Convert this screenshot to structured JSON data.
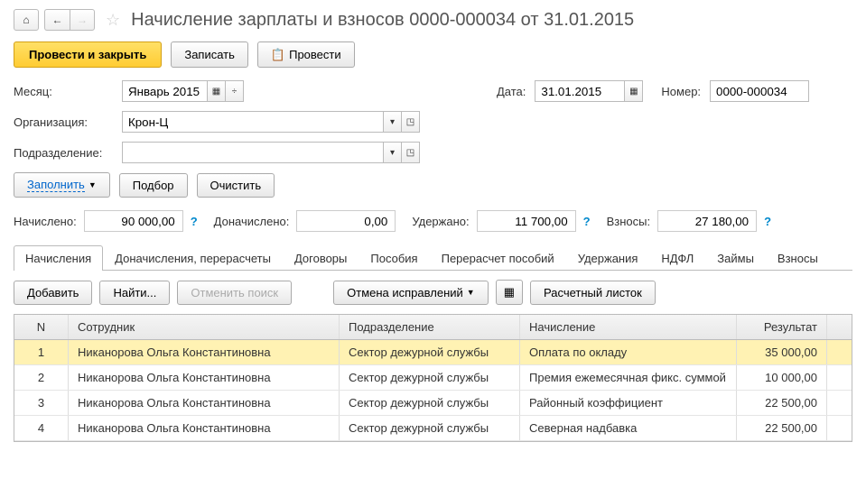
{
  "nav": {
    "home": "⌂",
    "back": "←",
    "fwd": "→"
  },
  "title": "Начисление зарплаты и взносов 0000-000034 от 31.01.2015",
  "toolbar": {
    "post_close": "Провести и закрыть",
    "save": "Записать",
    "post": "Провести"
  },
  "form": {
    "month_label": "Месяц:",
    "month_value": "Январь 2015",
    "date_label": "Дата:",
    "date_value": "31.01.2015",
    "number_label": "Номер:",
    "number_value": "0000-000034",
    "org_label": "Организация:",
    "org_value": "Крон-Ц",
    "dept_label": "Подразделение:",
    "dept_value": ""
  },
  "actions": {
    "fill": "Заполнить",
    "select": "Подбор",
    "clear": "Очистить"
  },
  "totals": {
    "accrued_label": "Начислено:",
    "accrued": "90 000,00",
    "add_accrued_label": "Доначислено:",
    "add_accrued": "0,00",
    "withheld_label": "Удержано:",
    "withheld": "11 700,00",
    "contrib_label": "Взносы:",
    "contrib": "27 180,00"
  },
  "tabs": [
    "Начисления",
    "Доначисления, перерасчеты",
    "Договоры",
    "Пособия",
    "Перерасчет пособий",
    "Удержания",
    "НДФЛ",
    "Займы",
    "Взносы"
  ],
  "sub_toolbar": {
    "add": "Добавить",
    "find": "Найти...",
    "cancel_search": "Отменить поиск",
    "cancel_fix": "Отмена исправлений",
    "payslip": "Расчетный листок"
  },
  "grid": {
    "headers": {
      "n": "N",
      "emp": "Сотрудник",
      "dept": "Подразделение",
      "accr": "Начисление",
      "res": "Результат"
    },
    "rows": [
      {
        "n": "1",
        "emp": "Никанорова Ольга Константиновна",
        "dept": "Сектор дежурной службы",
        "accr": "Оплата по окладу",
        "res": "35 000,00",
        "selected": true
      },
      {
        "n": "2",
        "emp": "Никанорова Ольга Константиновна",
        "dept": "Сектор дежурной службы",
        "accr": "Премия ежемесячная фикс. суммой",
        "res": "10 000,00"
      },
      {
        "n": "3",
        "emp": "Никанорова Ольга Константиновна",
        "dept": "Сектор дежурной службы",
        "accr": "Районный коэффициент",
        "res": "22 500,00"
      },
      {
        "n": "4",
        "emp": "Никанорова Ольга Константиновна",
        "dept": "Сектор дежурной службы",
        "accr": "Северная надбавка",
        "res": "22 500,00"
      }
    ]
  }
}
